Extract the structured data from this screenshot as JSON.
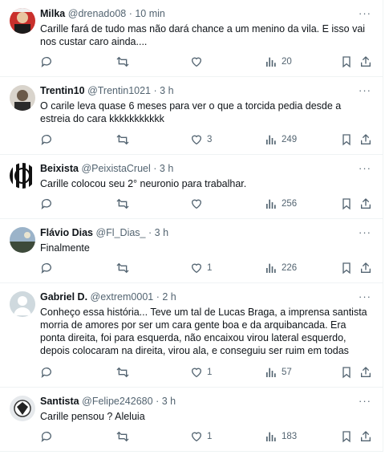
{
  "tweets": [
    {
      "name": "Milka",
      "handle": "@drenado08",
      "time": "10 min",
      "text": "Carille fará de tudo mas não dará chance a um menino da vila. E isso vai nos custar caro ainda....",
      "likes": "",
      "views": "20"
    },
    {
      "name": "Trentin10",
      "handle": "@Trentin1021",
      "time": "3 h",
      "text": "O carile leva quase 6 meses para ver o que a torcida pedia desde a estreia do cara kkkkkkkkkkk",
      "likes": "3",
      "views": "249"
    },
    {
      "name": "Beixista",
      "handle": "@PeixistaCruel",
      "time": "3 h",
      "text": "Carille colocou seu 2° neuronio para trabalhar.",
      "likes": "",
      "views": "256"
    },
    {
      "name": "Flávio Dias",
      "handle": "@Fl_Dias_",
      "time": "3 h",
      "text": "Finalmente",
      "likes": "1",
      "views": "226"
    },
    {
      "name": "Gabriel D.",
      "handle": "@extrem0001",
      "time": "2 h",
      "text": "Conheço essa história... Teve um tal de Lucas Braga, a imprensa santista morria de amores por ser um cara gente boa e da arquibancada. Era ponta direita, foi para esquerda, não encaixou virou lateral esquerdo, depois colocaram na direita, virou ala, e conseguiu ser ruim em todas",
      "likes": "1",
      "views": "57"
    },
    {
      "name": "Santista",
      "handle": "@Felipe242680",
      "time": "3 h",
      "text": "Carille pensou ? Aleluia",
      "likes": "1",
      "views": "183"
    }
  ],
  "ui": {
    "separator": "·",
    "more": "···"
  },
  "colors": {
    "text": "#0f1419",
    "muted": "#536471",
    "border": "#eff3f4"
  }
}
